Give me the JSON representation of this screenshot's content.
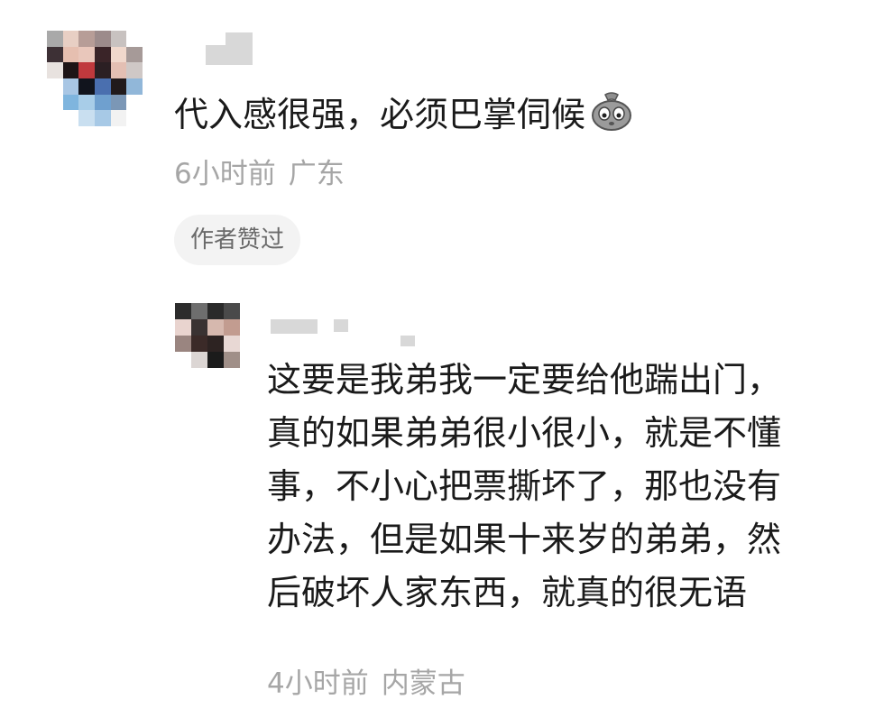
{
  "comment": {
    "text": "代入感很强，必须巴掌伺候",
    "emoji_icon": "sad-bag-emoji-icon",
    "time": "6小时前",
    "location": "广东",
    "author_liked_label": "作者赞过",
    "avatar_pixels": [
      "#a9a9a9",
      "#e8cfc4",
      "#b79d97",
      "#9c8b8b",
      "#c8c2c0",
      "#ffffff",
      "#3d3035",
      "#e6bfb0",
      "#e9c7bb",
      "#3a2428",
      "#f0d8cc",
      "#a69a98",
      "#e8e2df",
      "#1d1416",
      "#c0393d",
      "#2b1f23",
      "#e3bfb3",
      "#cfc8c6",
      "#ffffff",
      "#a8c6e4",
      "#11141d",
      "#4a6faf",
      "#211a1c",
      "#91b7d9",
      "#ffffff",
      "#7fb5de",
      "#a8cde8",
      "#6fa0cf",
      "#7b97b6",
      "#ffffff",
      "#ffffff",
      "#ffffff",
      "#c9dff0",
      "#a7c9e6",
      "#f2f2f2",
      "#ffffff"
    ],
    "username_blocks_color": "#d8d8d8"
  },
  "reply": {
    "lines": [
      "这要是我弟我一定要给他踹出门，",
      "真的如果弟弟很小很小，就是不懂",
      "事，不小心把票撕坏了，那也没有",
      "办法，但是如果十来岁的弟弟，然",
      "后破坏人家东西，就真的很无语"
    ],
    "time": "4小时前",
    "location": "内蒙古",
    "avatar_pixels": [
      "#2c2c2c",
      "#6e6e6e",
      "#2a2a2a",
      "#4a4a4a",
      "#e9d4cf",
      "#3a3232",
      "#d6b8ae",
      "#c29c90",
      "#9a8580",
      "#3b2a28",
      "#2d2322",
      "#e8d8d4",
      "#ffffff",
      "#dcd6d4",
      "#1b1b1b",
      "#a08f88"
    ]
  }
}
